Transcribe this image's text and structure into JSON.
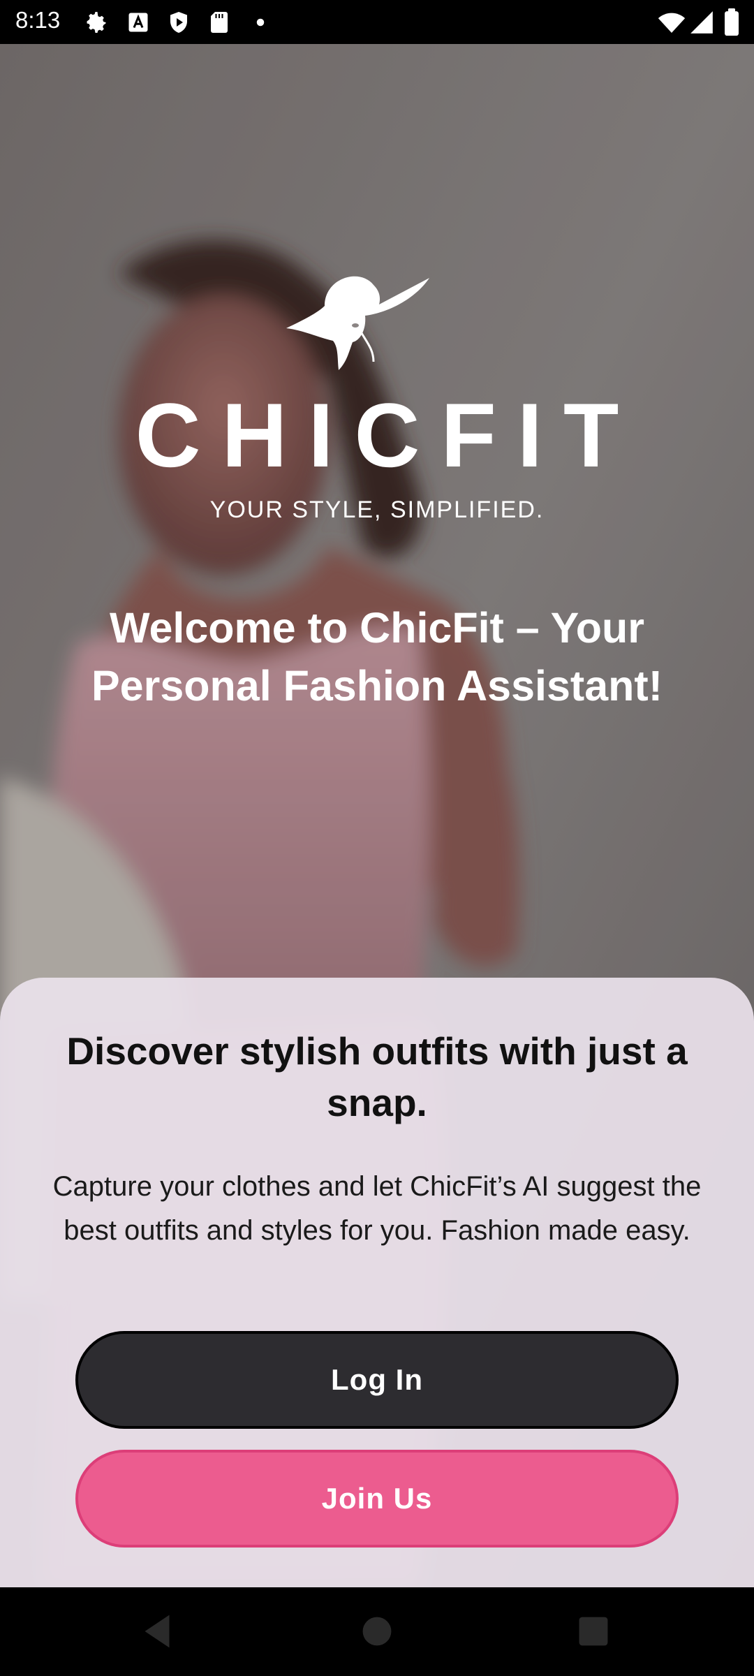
{
  "status_bar": {
    "time": "8:13",
    "left_icons": [
      "gear-icon",
      "font-a-icon",
      "play-shield-icon",
      "sd-card-icon",
      "dot-icon"
    ],
    "right_icons": [
      "wifi-icon",
      "cellular-signal-icon",
      "battery-icon"
    ]
  },
  "brand": {
    "name": "CHICFIT",
    "tagline": "YOUR STYLE, SIMPLIFIED.",
    "logo_icon": "woman-hat-logo-icon"
  },
  "hero": {
    "welcome_title": "Welcome to ChicFit – Your Personal Fashion Assistant!"
  },
  "sheet": {
    "title": "Discover stylish outfits with just a snap.",
    "body": "Capture your clothes and let ChicFit’s AI suggest the best outfits and styles for you. Fashion made easy.",
    "login_label": "Log In",
    "join_label": "Join Us"
  },
  "nav_bar": {
    "icons": [
      "back-triangle-icon",
      "home-circle-icon",
      "recents-square-icon"
    ]
  },
  "colors": {
    "login_button": "#2d2c30",
    "join_button": "#ec5c8f",
    "sheet_background": "#e9e1eb"
  }
}
